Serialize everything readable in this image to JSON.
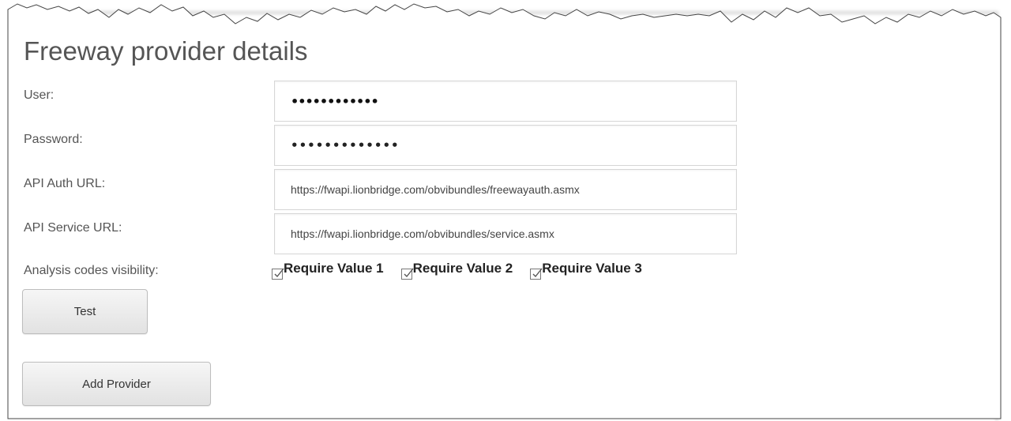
{
  "title": "Freeway provider details",
  "fields": {
    "user": {
      "label": "User:",
      "value": "••••••••••••"
    },
    "password": {
      "label": "Password:",
      "value": "•••••••••••••"
    },
    "api_auth_url": {
      "label": "API Auth URL:",
      "value": "https://fwapi.lionbridge.com/obvibundles/freewayauth.asmx"
    },
    "api_service_url": {
      "label": "API Service URL:",
      "value": "https://fwapi.lionbridge.com/obvibundles/service.asmx"
    }
  },
  "analysis": {
    "label": "Analysis codes visibility:",
    "checkboxes": [
      {
        "label": "Require Value 1",
        "checked": true
      },
      {
        "label": "Require Value 2",
        "checked": true
      },
      {
        "label": "Require Value 3",
        "checked": true
      }
    ]
  },
  "buttons": {
    "test": "Test",
    "add_provider": "Add Provider"
  }
}
